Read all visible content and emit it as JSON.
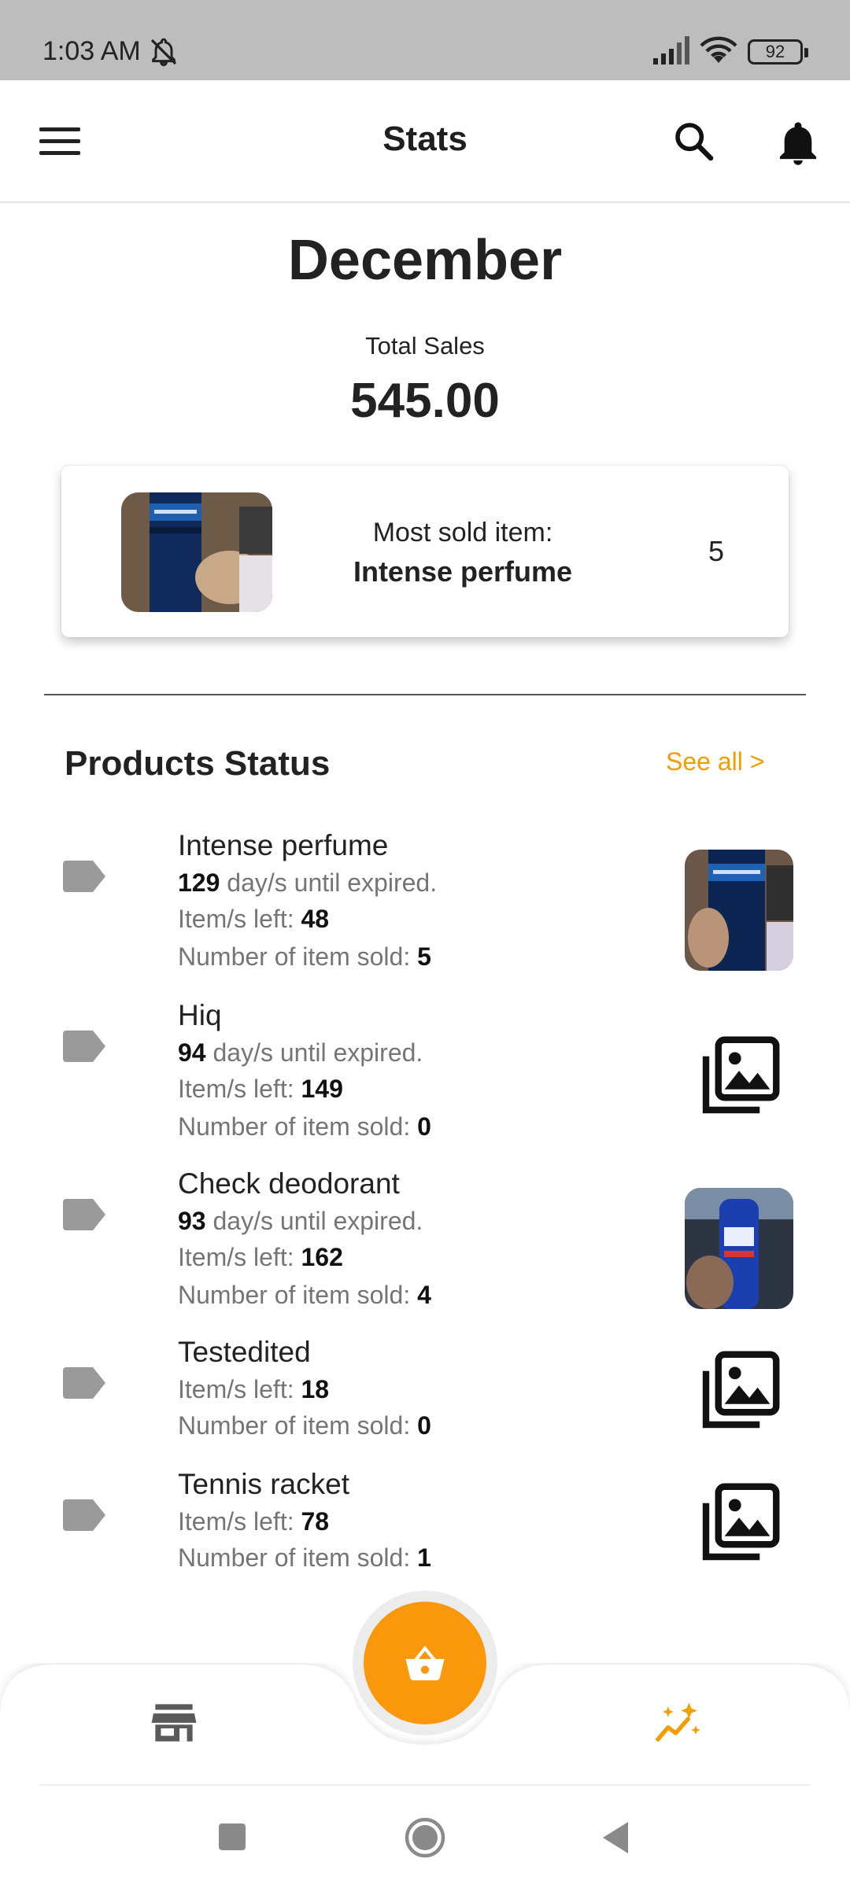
{
  "status_bar": {
    "time": "1:03 AM",
    "battery": "92",
    "icons": [
      "notifications-off-icon",
      "signal-icon",
      "wifi-icon",
      "battery-icon"
    ]
  },
  "app_bar": {
    "title": "Stats",
    "icons": [
      "menu-icon",
      "search-icon",
      "bell-icon"
    ]
  },
  "summary": {
    "month": "December",
    "total_sales_label": "Total Sales",
    "total_sales_value": "545.00"
  },
  "most_sold": {
    "label": "Most sold item:",
    "name": "Intense perfume",
    "count": "5"
  },
  "products_status": {
    "title": "Products Status",
    "see_all": "See all >",
    "items": [
      {
        "name": "Intense perfume",
        "days_value": "129",
        "days_text": " day/s until expired.",
        "left_label": "Item/s left: ",
        "left_value": "48",
        "sold_label": "Number of item sold: ",
        "sold_value": "5",
        "image": "photo"
      },
      {
        "name": "Hiq",
        "days_value": "94",
        "days_text": " day/s until expired.",
        "left_label": "Item/s left: ",
        "left_value": "149",
        "sold_label": "Number of item sold: ",
        "sold_value": "0",
        "image": "placeholder"
      },
      {
        "name": "Check deodorant",
        "days_value": "93",
        "days_text": " day/s until expired.",
        "left_label": "Item/s left: ",
        "left_value": "162",
        "sold_label": "Number of item sold: ",
        "sold_value": "4",
        "image": "photo"
      },
      {
        "name": "Testedited",
        "left_label": "Item/s left: ",
        "left_value": "18",
        "sold_label": "Number of item sold: ",
        "sold_value": "0",
        "image": "placeholder"
      },
      {
        "name": "Tennis racket",
        "left_label": "Item/s left: ",
        "left_value": "78",
        "sold_label": "Number of item sold: ",
        "sold_value": "1",
        "image": "placeholder"
      }
    ]
  },
  "bottom_nav": {
    "items": [
      "store-icon",
      "basket-icon",
      "stats-icon"
    ],
    "active": "stats-icon"
  },
  "colors": {
    "accent": "#f29d00",
    "fab": "#f9980b",
    "status_bar": "#bdbdbd"
  }
}
